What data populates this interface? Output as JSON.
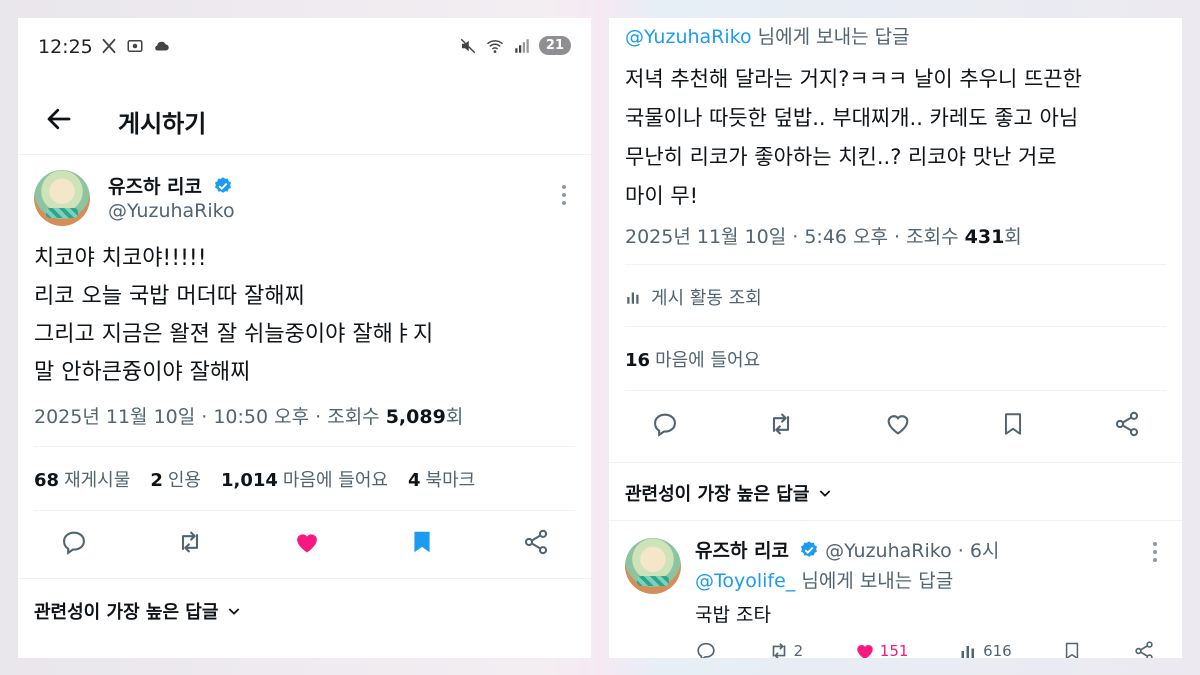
{
  "status_bar": {
    "time": "12:25",
    "battery": "21"
  },
  "header": {
    "title": "게시하기"
  },
  "tweet": {
    "display_name": "유즈하 리코",
    "handle": "@YuzuhaRiko",
    "lines": [
      "치코야 치코야!!!!!",
      "리코 오늘 국밥 머더따 잘해찌",
      "그리고 지금은 왈젼 잘 쉬늘중이야 잘해ㅑ지",
      "말 안하큰즁이야 잘해찌"
    ],
    "meta_prefix": "2025년 11월 10일 · 10:50 오후 · 조회수 ",
    "views": "5,089",
    "views_suffix": "회",
    "stats": {
      "retweets": "68",
      "retweets_label": "재게시물",
      "quotes": "2",
      "quotes_label": "인용",
      "likes": "1,014",
      "likes_label": "마음에 들어요",
      "bookmarks": "4",
      "bookmarks_label": "북마크"
    }
  },
  "left_section_title": "관련성이 가장 높은 답글",
  "reply_tweet": {
    "reply_to_handle": "@YuzuhaRiko",
    "reply_to_suffix": " 님에게 보내는 답글",
    "lines": [
      "저녁 추천해 달라는 거지?ㅋㅋㅋ 날이 추우니 뜨끈한",
      "국물이나 따듯한 덮밥.. 부대찌개.. 카레도 좋고 아님",
      "무난히 리코가 좋아하는 치킨..? 리코야 맛난 거로",
      "마이 무!"
    ],
    "meta_prefix": "2025년 11월 10일 · 5:46 오후 · 조회수 ",
    "views": "431",
    "views_suffix": "회",
    "activity_label": "게시 활동 조회",
    "likes_count": "16",
    "likes_label": "마음에 들어요"
  },
  "right_section_title": "관련성이 가장 높은 답글",
  "sub_reply": {
    "display_name": "유즈하 리코",
    "handle": "@YuzuhaRiko",
    "time": " · 6시",
    "reply_to_handle": "@Toyolife_",
    "reply_to_suffix": " 님에게 보내는 답글",
    "text": "국밥 조타",
    "retweets": "2",
    "likes": "151",
    "views": "616"
  },
  "colors": {
    "accent_blue": "#1d9bf0",
    "like_pink": "#f91880",
    "text_primary": "#0f1419",
    "text_secondary": "#536471"
  },
  "icons": [
    "back-arrow-icon",
    "verified-badge-icon",
    "more-icon",
    "reply-icon",
    "retweet-icon",
    "heart-icon",
    "bookmark-icon",
    "share-icon",
    "analytics-icon",
    "chevron-down-icon"
  ]
}
